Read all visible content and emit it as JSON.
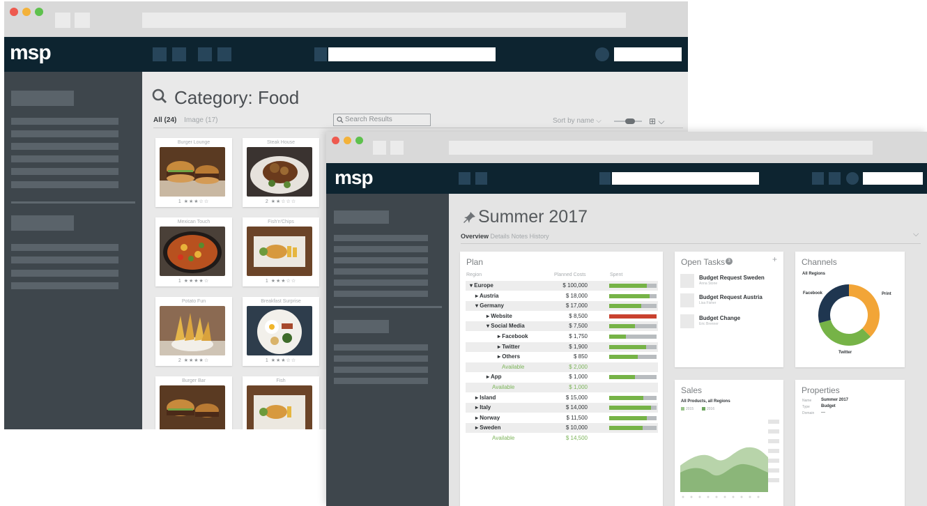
{
  "back_window": {
    "logo": "msp",
    "page_title": "Category: Food",
    "tabs": [
      {
        "label": "All (24)"
      },
      {
        "label": "Image (17)"
      }
    ],
    "search_placeholder": "Search Results",
    "sort_label": "Sort by name",
    "cards": [
      {
        "title": "Burger Lounge",
        "rating": "1 ★★★☆☆"
      },
      {
        "title": "Steak House",
        "rating": "2 ★★☆☆☆"
      },
      {
        "title": "Mexican Touch",
        "rating": "1 ★★★★☆"
      },
      {
        "title": "Fish'n'Chips",
        "rating": "1 ★★★☆☆"
      },
      {
        "title": "Potato Fun",
        "rating": "2 ★★★★☆"
      },
      {
        "title": "Breakfast Surprise",
        "rating": "1 ★★★☆☆"
      },
      {
        "title": "Burger Bar",
        "rating": ""
      },
      {
        "title": "Fish",
        "rating": ""
      }
    ]
  },
  "front_window": {
    "logo": "msp",
    "page_title": "Summer 2017",
    "tabs": [
      {
        "label": "Overview"
      },
      {
        "label": "Details"
      },
      {
        "label": "Notes"
      },
      {
        "label": "History"
      }
    ],
    "plan": {
      "title": "Plan",
      "columns": {
        "region": "Region",
        "planned": "Planned Costs",
        "spent": "Spent"
      },
      "rows": [
        {
          "label": "▾ Europe",
          "value": "$ 100,000",
          "spent": 0.8,
          "color": "#76b347"
        },
        {
          "label": "▸ Austria",
          "value": "$ 18,000",
          "spent": 0.85,
          "color": "#76b347"
        },
        {
          "label": "▾ Germany",
          "value": "$ 17,000",
          "spent": 0.68,
          "color": "#76b347"
        },
        {
          "label": "▸ Website",
          "value": "$ 8,500",
          "spent": 1.0,
          "color": "#c9422f"
        },
        {
          "label": "▾ Social Media",
          "value": "$ 7,500",
          "spent": 0.55,
          "color": "#76b347"
        },
        {
          "label": "▸ Facebook",
          "value": "$ 1,750",
          "spent": 0.35,
          "color": "#76b347"
        },
        {
          "label": "▸ Twitter",
          "value": "$ 1,900",
          "spent": 0.78,
          "color": "#76b347"
        },
        {
          "label": "▸ Others",
          "value": "$ 850",
          "spent": 0.6,
          "color": "#76b347"
        },
        {
          "label": "Available",
          "value": "$ 2,000",
          "spent": null,
          "color": null
        },
        {
          "label": "▸ App",
          "value": "$ 1,000",
          "spent": 0.55,
          "color": "#76b347"
        },
        {
          "label": "Available",
          "value": "$ 1,000",
          "spent": null,
          "color": null
        },
        {
          "label": "▸ Island",
          "value": "$ 15,000",
          "spent": 0.72,
          "color": "#76b347"
        },
        {
          "label": "▸ Italy",
          "value": "$ 14,000",
          "spent": 0.88,
          "color": "#76b347"
        },
        {
          "label": "▸ Norway",
          "value": "$ 11,500",
          "spent": 0.8,
          "color": "#76b347"
        },
        {
          "label": "▸ Sweden",
          "value": "$ 10,000",
          "spent": 0.7,
          "color": "#76b347"
        },
        {
          "label": "Available",
          "value": "$ 14,500",
          "spent": null,
          "color": null
        }
      ]
    },
    "open_tasks": {
      "title": "Open Tasks",
      "count": "3",
      "items": [
        {
          "title": "Budget Request Sweden",
          "sub": "Anna Stone"
        },
        {
          "title": "Budget Request Austria",
          "sub": "Lisa Fisher"
        },
        {
          "title": "Budget Change",
          "sub": "Eric Brenner"
        }
      ]
    },
    "channels": {
      "title": "Channels",
      "subtitle": "All Regions",
      "chart_data": {
        "type": "pie",
        "donut": true,
        "slices": [
          {
            "label": "Print",
            "value": 37.5,
            "color": "#f2a537"
          },
          {
            "label": "Twitter",
            "value": 33.3,
            "color": "#76b347"
          },
          {
            "label": "Facebook",
            "value": 29.2,
            "color": "#1f3650"
          }
        ]
      }
    },
    "sales": {
      "title": "Sales",
      "subtitle": "All Products, all Regions",
      "legend": [
        "2015",
        "2016"
      ],
      "colors": {
        "series_2015": "#9bc48c",
        "series_2016": "#6ea660"
      }
    },
    "properties": {
      "title": "Properties",
      "rows": [
        {
          "key": "Name",
          "value": "Summer 2017"
        },
        {
          "key": "Type",
          "value": "Budget"
        },
        {
          "key": "Domain",
          "value": "—"
        }
      ]
    }
  }
}
